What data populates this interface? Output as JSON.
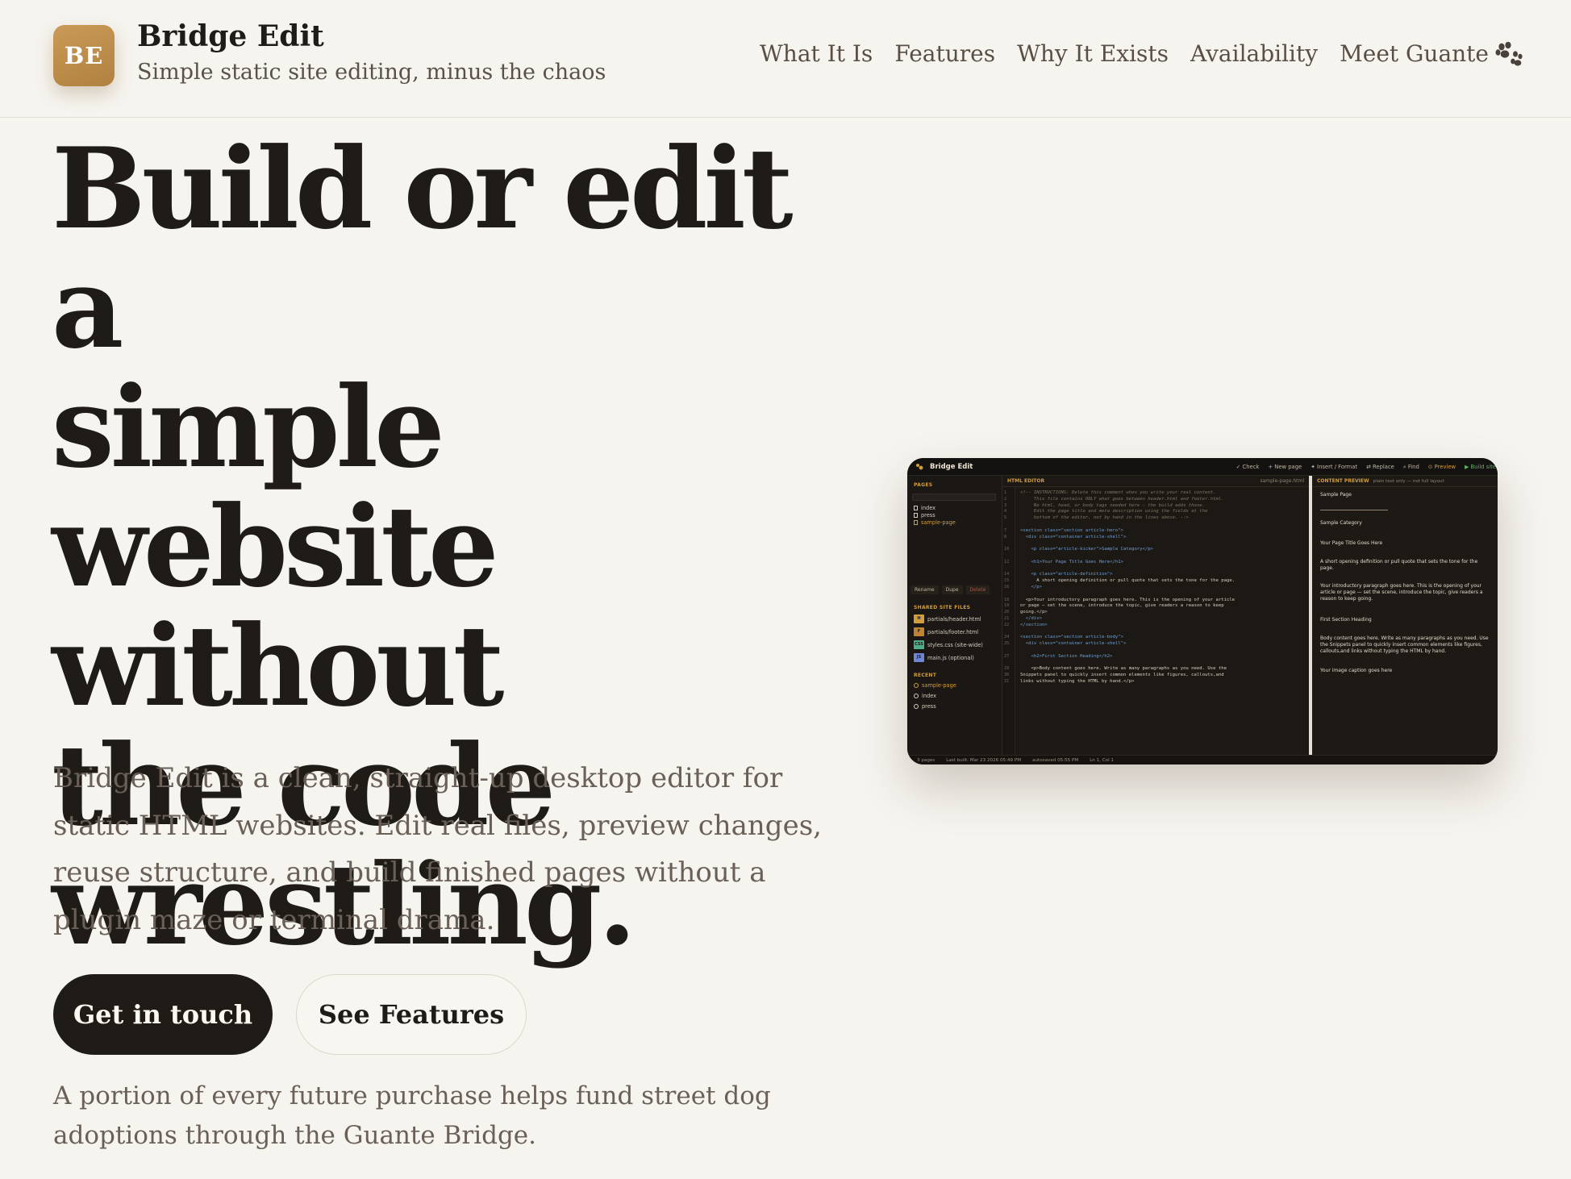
{
  "header": {
    "logo_initials": "BE",
    "brand_name": "Bridge Edit",
    "tagline": "Simple static site editing, minus the chaos",
    "nav": [
      {
        "label": "What It Is"
      },
      {
        "label": "Features"
      },
      {
        "label": "Why It Exists"
      },
      {
        "label": "Availability"
      },
      {
        "label": "Meet Guante",
        "icon": "paw-icon"
      }
    ]
  },
  "hero": {
    "title_lines": [
      "Build or edit a",
      "simple website",
      "without",
      "the code",
      "wrestling."
    ],
    "lead": "Bridge Edit is a clean, straight-up desktop editor for static HTML websites. Edit real files, preview changes, reuse structure, and build finished pages without a plugin maze or terminal drama.",
    "primary_button": "Get in touch",
    "secondary_button": "See Features",
    "note": "A portion of every future purchase helps fund street dog adoptions through the Guante Bridge."
  },
  "screenshot": {
    "app_title": "Bridge Edit",
    "toolbar": [
      "✓ Check",
      "+ New page",
      "✦ Insert / Format",
      "⇄ Replace",
      "⌕ Find",
      "⊙ Preview",
      "▶ Build site"
    ],
    "sidebar": {
      "pages_heading": "PAGES",
      "pages": [
        "index",
        "press",
        "sample-page"
      ],
      "active_page": "sample-page",
      "buttons": [
        "Rename",
        "Dupe",
        "Delete"
      ],
      "shared_heading": "SHARED SITE FILES",
      "shared_files": [
        {
          "badge": "H",
          "name": "partials/header.html",
          "color": "#d39d3c"
        },
        {
          "badge": "F",
          "name": "partials/footer.html",
          "color": "#c0832f"
        },
        {
          "badge": "CSS",
          "name": "styles.css (site-wide)",
          "color": "#4fae86"
        },
        {
          "badge": "JS",
          "name": "main.js (optional)",
          "color": "#6f86d6"
        }
      ],
      "recent_heading": "RECENT",
      "recent": [
        "sample-page",
        "index",
        "press"
      ]
    },
    "editor": {
      "heading": "HTML EDITOR",
      "file": "sample-page.html",
      "lines": [
        {
          "n": "1",
          "text": "<!-- INSTRUCTIONS: Delete this comment when you write your real content.",
          "kind": "cm"
        },
        {
          "n": "2",
          "text": "     This file contains ONLY what goes between header.html and footer.html.",
          "kind": "cm"
        },
        {
          "n": "3",
          "text": "     No html, head, or body tags needed here — the build adds those.",
          "kind": "cm"
        },
        {
          "n": "4",
          "text": "     Edit the page title and meta description using the fields at the",
          "kind": "cm"
        },
        {
          "n": "5",
          "text": "     bottom of the editor, not by hand in the lines above. -->",
          "kind": "cm"
        },
        {
          "n": "7",
          "text": "<section class=\"section article-hero\">",
          "kind": "tag"
        },
        {
          "n": "8",
          "text": "  <div class=\"container article-shell\">",
          "kind": "tag"
        },
        {
          "n": "10",
          "text": "    <p class=\"article-kicker\">Sample Category</p>",
          "kind": "tag"
        },
        {
          "n": "12",
          "text": "    <h1>Your Page Title Goes Here</h1>",
          "kind": "tag"
        },
        {
          "n": "14",
          "text": "    <p class=\"article-definition\">",
          "kind": "tag"
        },
        {
          "n": "15",
          "text": "      A short opening definition or pull quote that sets the tone for the page.",
          "kind": "txt"
        },
        {
          "n": "16",
          "text": "    </p>",
          "kind": "tag"
        },
        {
          "n": "18",
          "text": "  <p>Your introductory paragraph goes here. This is the opening of your article",
          "kind": "txt"
        },
        {
          "n": "19",
          "text": "or page — set the scene, introduce the topic, give readers a reason to keep",
          "kind": "txt"
        },
        {
          "n": "20",
          "text": "going.</p>",
          "kind": "txt"
        },
        {
          "n": "21",
          "text": "  </div>",
          "kind": "tag"
        },
        {
          "n": "22",
          "text": "</section>",
          "kind": "tag"
        },
        {
          "n": "24",
          "text": "<section class=\"section article-body\">",
          "kind": "tag"
        },
        {
          "n": "25",
          "text": "  <div class=\"container article-shell\">",
          "kind": "tag"
        },
        {
          "n": "27",
          "text": "    <h2>First Section Heading</h2>",
          "kind": "tag"
        },
        {
          "n": "29",
          "text": "    <p>Body content goes here. Write as many paragraphs as you need. Use the",
          "kind": "txt"
        },
        {
          "n": "30",
          "text": "Snippets panel to quickly insert common elements like figures, callouts,and",
          "kind": "txt"
        },
        {
          "n": "31",
          "text": "links without typing the HTML by hand.</p>",
          "kind": "txt"
        }
      ]
    },
    "preview": {
      "heading": "CONTENT PREVIEW",
      "subheading": "plain text only — not full layout",
      "blocks": [
        "Sample Page",
        "Sample Category",
        "Your Page Title Goes Here",
        "A short opening definition or pull quote that sets the tone for the page.",
        "Your introductory paragraph goes here. This is the opening of your article or page — set the scene, introduce the topic, give readers a reason to keep going.",
        "First Section Heading",
        "Body content goes here. Write as many paragraphs as you need. Use the Snippets panel to quickly insert common elements like figures, callouts,and links without typing the HTML by hand.",
        "Your image caption goes here"
      ]
    },
    "status": [
      "3 pages",
      "Last built: Mar 23 2026 05:49 PM",
      "autosaved 05:55 PM",
      "Ln 1, Col 1"
    ]
  },
  "colors": {
    "background": "#f6f4ef",
    "ink": "#1f1b17",
    "accent": "#b98a45",
    "muted": "#6a6058"
  }
}
